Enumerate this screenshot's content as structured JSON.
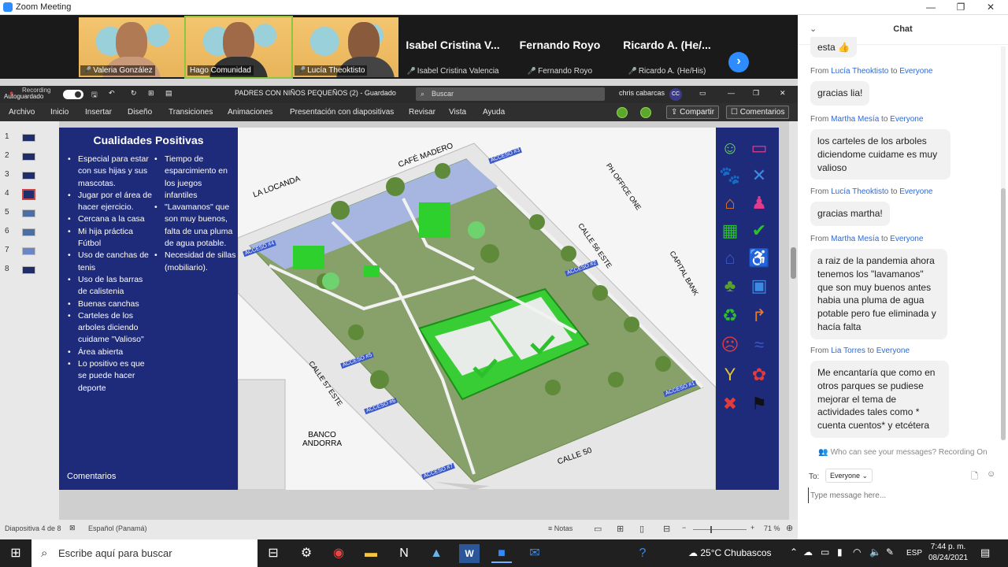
{
  "window": {
    "title": "Zoom Meeting",
    "controls": [
      "—",
      "❐",
      "✕"
    ]
  },
  "participants": [
    {
      "name": "Valeria González",
      "type": "video"
    },
    {
      "name": "Hago Comunidad",
      "type": "video"
    },
    {
      "name": "Lucía Theoktisto",
      "type": "video"
    },
    {
      "big": "Isabel Cristina V...",
      "name": "Isabel Cristina Valencia",
      "type": "name"
    },
    {
      "big": "Fernando Royo",
      "name": "Fernando Royo",
      "type": "name"
    },
    {
      "big": "Ricardo A. (He/...",
      "name": "Ricardo A. (He/His)",
      "type": "name"
    }
  ],
  "ppt": {
    "recording": "Recording",
    "autosave": "Autoguardado",
    "doc_title": "PADRES CON NIÑOS PEQUEÑOS (2)  -  Guardado",
    "search_placeholder": "Buscar",
    "user": "chris cabarcas",
    "user_initials": "CC",
    "menu": [
      "Archivo",
      "Inicio",
      "Insertar",
      "Diseño",
      "Transiciones",
      "Animaciones",
      "Presentación con diapositivas",
      "Revisar",
      "Vista",
      "Ayuda"
    ],
    "share": "Compartir",
    "comments": "Comentarios",
    "thumb_numbers": [
      "1",
      "2",
      "3",
      "4",
      "5",
      "6",
      "7",
      "8"
    ],
    "status": {
      "slide": "Diapositiva 4 de 8",
      "lang": "Español (Panamá)",
      "notes": "Notas",
      "zoom": "71 %"
    }
  },
  "slide": {
    "title": "Cualidades Positivas",
    "col1": [
      "Especial para estar con sus hijas y sus mascotas.",
      "Jugar por el área de hacer ejercicio.",
      "Cercana a la casa",
      "Mi hija práctica Fútbol",
      "Uso de canchas de tenis",
      "Uso de las barras de calistenia",
      "Buenas canchas",
      "Carteles de los arboles diciendo cuidame \"Valioso\"",
      "Área abierta",
      "Lo positivo es que se puede hacer deporte"
    ],
    "col2": [
      "Tiempo de esparcimiento en los juegos infantiles",
      "\"Lavamanos\" que son muy buenos, falta de una pluma de agua potable.",
      "Necesidad de sillas (mobiliario)."
    ],
    "footer": "Comentarios",
    "map_labels": {
      "cafe": "CAFÉ MADERO",
      "locanda": "LA LOCANDA",
      "ph": "PH OFFICE ONE",
      "calle56": "CALLE 56 ESTE",
      "capital": "CAPITAL BANK",
      "calle57": "CALLE 57 ESTE",
      "banco": "BANCO ANDORRA",
      "calle50": "CALLE 50",
      "a1": "ACCESO #1",
      "a2": "ACCESO #2",
      "a3": "ACCESO #3",
      "a4": "ACCESO #4",
      "a5": "ACCESO #5",
      "a6": "ACCESO #6",
      "a7": "ACCESO #7"
    }
  },
  "chat": {
    "title": "Chat",
    "first_fragment": "esta 👍",
    "messages": [
      {
        "from": "Lucía Theoktisto",
        "to": "Everyone",
        "text": "gracias lia!"
      },
      {
        "from": "Martha Mesía",
        "to": "Everyone",
        "text": "los carteles de los arboles diciendome cuidame es muy valioso"
      },
      {
        "from": "Lucía Theoktisto",
        "to": "Everyone",
        "text": "gracias martha!"
      },
      {
        "from": "Martha Mesía",
        "to": "Everyone",
        "text": "a raiz de la pandemia ahora tenemos los \"lavamanos\" que son muy buenos antes habia una pluma de agua potable pero fue eliminada y hacía falta"
      },
      {
        "from": "Lia Torres",
        "to": "Everyone",
        "text": "Me encantaría que como en otros parques se pudiese mejorar el tema de actividades tales como * cuenta cuentos* y etcétera"
      }
    ],
    "from_word": "From",
    "to_word": "to",
    "privacy": "Who can see your messages? Recording On",
    "to_label": "To:",
    "recipient": "Everyone",
    "placeholder": "Type message here..."
  },
  "taskbar": {
    "search": "Escribe aquí para buscar",
    "weather": "25°C  Chubascos",
    "lang": "ESP",
    "time": "7:44 p. m.",
    "date": "08/24/2021"
  }
}
